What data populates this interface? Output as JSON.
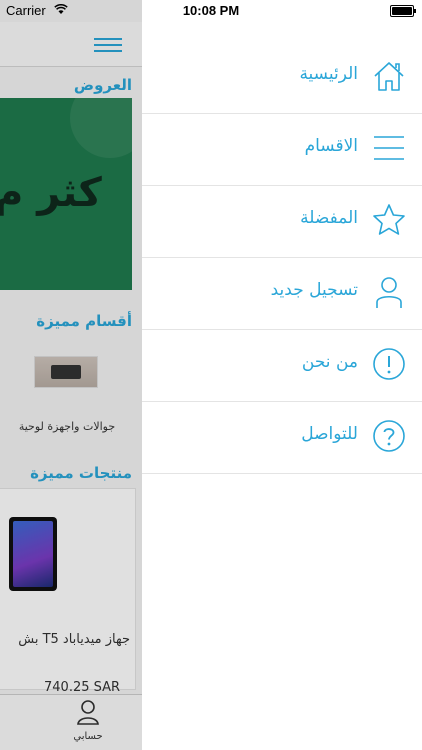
{
  "status_bar": {
    "carrier": "Carrier",
    "time": "10:08 PM",
    "battery_level": 1.0
  },
  "colors": {
    "accent": "#2aa6d8",
    "banner_green": "#1f7a4e"
  },
  "background_app": {
    "offers_title": "العروض",
    "banner_text": "كثر م",
    "featured_categories_title": "أقسام مميزة",
    "category_label": "جوالات واجهزة لوحية",
    "featured_products_title": "منتجات مميزة",
    "product_name": "جهاز ميدياباد T5 بش",
    "product_price": "740.25 SAR",
    "tab_account_label": "حسابي"
  },
  "menu": {
    "items": [
      {
        "label": "الرئيسية",
        "icon": "home-icon"
      },
      {
        "label": "الاقسام",
        "icon": "menu-lines-icon"
      },
      {
        "label": "المفضلة",
        "icon": "star-icon"
      },
      {
        "label": "تسجيل جديد",
        "icon": "user-icon"
      },
      {
        "label": "من نحن",
        "icon": "exclamation-circle-icon"
      },
      {
        "label": "للتواصل",
        "icon": "question-circle-icon"
      }
    ]
  }
}
